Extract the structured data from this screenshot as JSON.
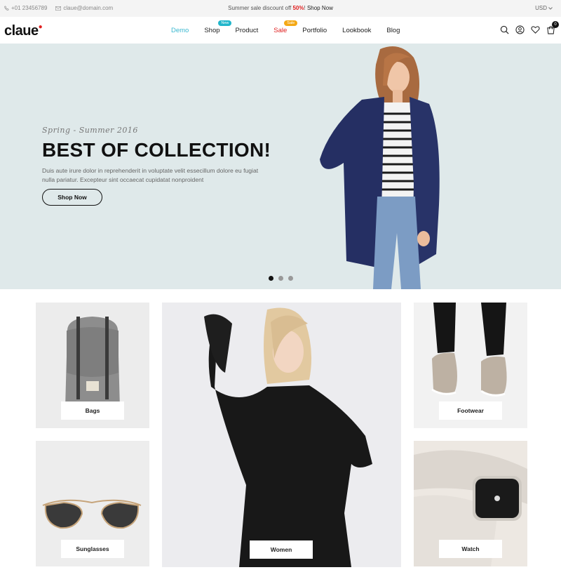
{
  "topbar": {
    "phone": "+01 23456789",
    "email": "claue@domain.com",
    "promo_text": "Summer sale discount off ",
    "promo_percent": "50%",
    "promo_exclaim": "! ",
    "promo_link": "Shop Now",
    "currency": "USD"
  },
  "header": {
    "logo": "claue",
    "nav": [
      {
        "label": "Demo"
      },
      {
        "label": "Shop",
        "badge": "New"
      },
      {
        "label": "Product"
      },
      {
        "label": "Sale",
        "badge": "Sale"
      },
      {
        "label": "Portfolio"
      },
      {
        "label": "Lookbook"
      },
      {
        "label": "Blog"
      }
    ],
    "cart_count": "0",
    "icons": [
      "search-icon",
      "user-icon",
      "heart-icon",
      "cart-icon"
    ]
  },
  "hero": {
    "subtitle": "Spring - Summer 2016",
    "title": "BEST OF COLLECTION!",
    "description": "Duis aute irure dolor in reprehenderit in voluptate velit essecillum dolore eu fugiat nulla pariatur. Excepteur sint occaecat cupidatat nonproident",
    "button": "Shop Now",
    "slides": 3,
    "active_slide": 1
  },
  "categories": {
    "bags": "Bags",
    "sunglasses": "Sunglasses",
    "women": "Women",
    "footwear": "Footwear",
    "watch": "Watch"
  },
  "colors": {
    "accent": "#3bb8d0",
    "sale": "#e02020",
    "badge_new": "#21b6cb",
    "badge_sale": "#f4a814",
    "hero_bg": "#dfe9ea"
  }
}
